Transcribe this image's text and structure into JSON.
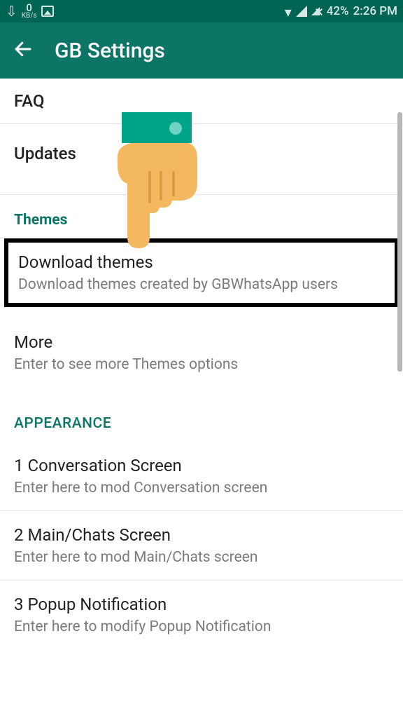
{
  "status": {
    "kbs_value": "0",
    "kbs_unit": "KB/s",
    "battery": "42%",
    "time": "2:26 PM"
  },
  "header": {
    "title": "GB Settings"
  },
  "rows": {
    "faq": "FAQ",
    "updates": "Updates"
  },
  "sections": {
    "themes_header": "Themes",
    "download_themes_title": "Download themes",
    "download_themes_sub": "Download themes created by GBWhatsApp users",
    "more_title": "More",
    "more_sub": "Enter to see more Themes options",
    "appearance_header": "APPEARANCE",
    "conv_title": "1 Conversation Screen",
    "conv_sub": "Enter here to mod Conversation screen",
    "main_title": "2 Main/Chats Screen",
    "main_sub": "Enter here to mod Main/Chats screen",
    "popup_title": "3 Popup Notification",
    "popup_sub": "Enter here to modify Popup Notification"
  }
}
